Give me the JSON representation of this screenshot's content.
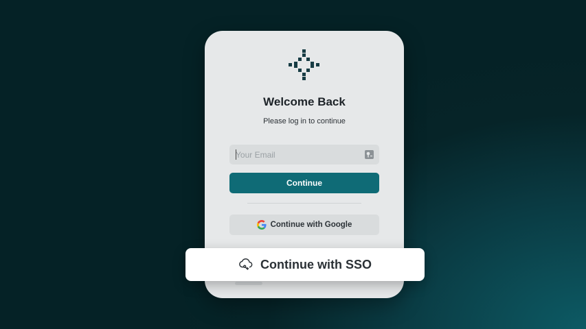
{
  "card": {
    "title": "Welcome Back",
    "subtitle": "Please log in to continue"
  },
  "email": {
    "placeholder": "Your Email",
    "value": "",
    "icon": "key-icon"
  },
  "buttons": {
    "continue_label": "Continue",
    "google_label": "Continue with Google",
    "sso_label": "Continue with SSO"
  },
  "icons": {
    "logo": "sparkle-logo-icon",
    "google": "google-icon",
    "sso": "cloud-sso-icon"
  },
  "colors": {
    "accent": "#0f6b76",
    "card_bg": "#e6e8e9",
    "background_dark": "#052226",
    "background_teal": "#0d5a64"
  }
}
